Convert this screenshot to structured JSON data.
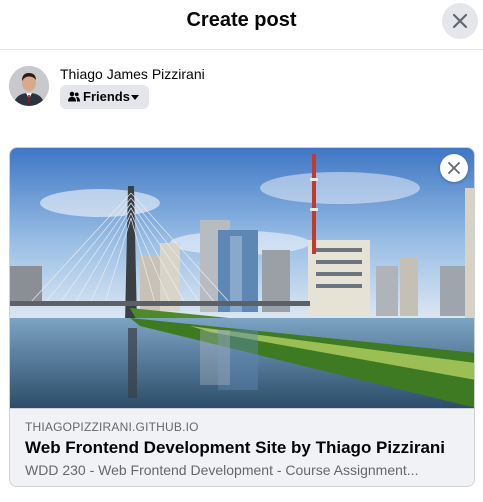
{
  "dialog": {
    "title": "Create post"
  },
  "author": {
    "name": "Thiago James Pizzirani",
    "audience_label": "Friends"
  },
  "link_preview": {
    "domain": "THIAGOPIZZIRANI.GITHUB.IO",
    "title": "Web Frontend Development Site by Thiago Pizzirani",
    "description": "WDD 230 - Web Frontend Development - Course Assignment..."
  },
  "icons": {
    "dialog_close": "close-icon",
    "audience": "people-icon",
    "audience_dropdown": "caret-down-icon",
    "preview_remove": "close-icon"
  },
  "colors": {
    "surface": "#ffffff",
    "button_gray": "#e4e6eb",
    "meta_bg": "#f0f2f5",
    "primary_text": "#050505",
    "secondary_text": "#65676b"
  }
}
